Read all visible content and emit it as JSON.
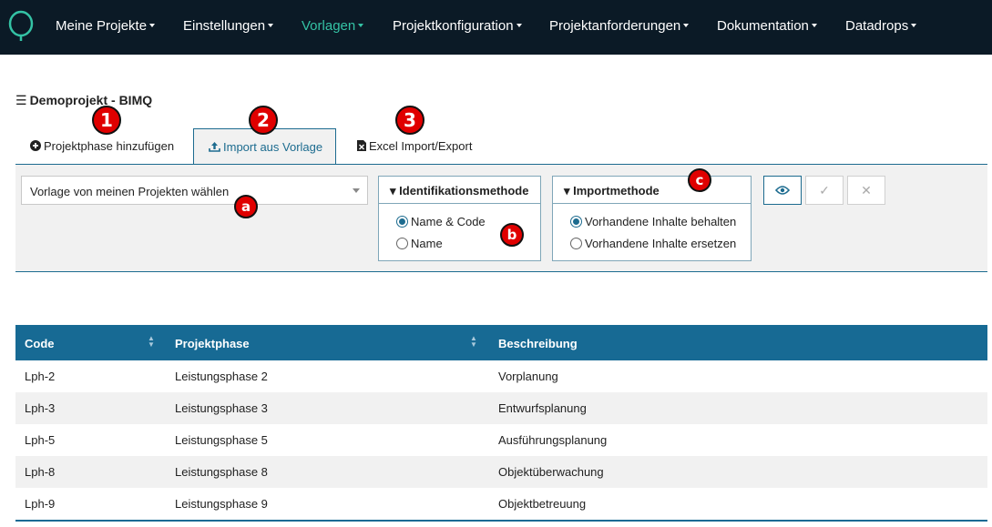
{
  "nav": {
    "items": [
      {
        "label": "Meine Projekte",
        "active": false
      },
      {
        "label": "Einstellungen",
        "active": false
      },
      {
        "label": "Vorlagen",
        "active": true
      },
      {
        "label": "Projektkonfiguration",
        "active": false
      },
      {
        "label": "Projektanforderungen",
        "active": false
      },
      {
        "label": "Dokumentation",
        "active": false
      },
      {
        "label": "Datadrops",
        "active": false
      }
    ],
    "accent_color": "#34c3a5",
    "background_color": "#0b1a26"
  },
  "page": {
    "title": "Demoprojekt - BIMQ"
  },
  "tabs": [
    {
      "label": "Projektphase hinzufügen",
      "icon": "plus-circle-icon",
      "active": false
    },
    {
      "label": "Import aus Vorlage",
      "icon": "upload-icon",
      "active": true
    },
    {
      "label": "Excel Import/Export",
      "icon": "excel-file-icon",
      "active": false
    }
  ],
  "import": {
    "template_select": "Vorlage von meinen Projekten wählen",
    "identification": {
      "title": "Identifikationsmethode",
      "options": [
        "Name & Code",
        "Name"
      ],
      "selected": "Name & Code"
    },
    "import_method": {
      "title": "Importmethode",
      "options": [
        "Vorhandene Inhalte behalten",
        "Vorhandene Inhalte ersetzen"
      ],
      "selected": "Vorhandene Inhalte behalten"
    },
    "buttons": {
      "preview_icon": "eye-icon",
      "confirm_icon": "check-icon",
      "cancel_icon": "close-icon",
      "preview_glyph": "◉",
      "confirm_glyph": "✓",
      "cancel_glyph": "✕"
    }
  },
  "annotations": {
    "badges": [
      "1",
      "2",
      "3",
      "a",
      "b",
      "c"
    ],
    "color": "#e00000"
  },
  "table": {
    "columns": [
      "Code",
      "Projektphase",
      "Beschreibung"
    ],
    "header_color": "#176a94",
    "rows": [
      [
        "Lph-2",
        "Leistungsphase 2",
        "Vorplanung"
      ],
      [
        "Lph-3",
        "Leistungsphase 3",
        "Entwurfsplanung"
      ],
      [
        "Lph-5",
        "Leistungsphase 5",
        "Ausführungsplanung"
      ],
      [
        "Lph-8",
        "Leistungsphase 8",
        "Objektüberwachung"
      ],
      [
        "Lph-9",
        "Leistungsphase 9",
        "Objektbetreuung"
      ]
    ]
  }
}
